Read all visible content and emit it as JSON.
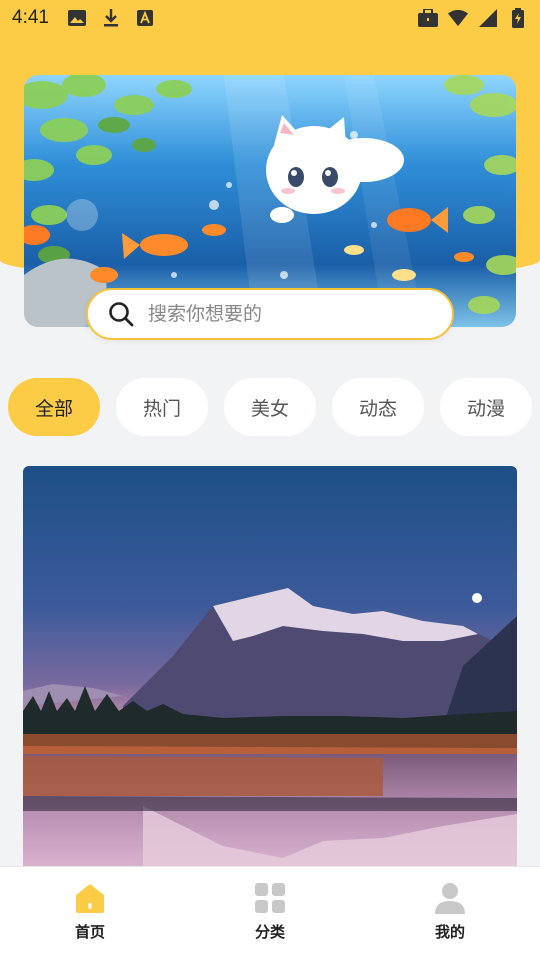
{
  "status_bar": {
    "time": "4:41",
    "left_icons": [
      "image-icon",
      "download-icon",
      "a-box-icon"
    ],
    "right_icons": [
      "briefcase-icon",
      "wifi-icon",
      "signal-icon",
      "battery-icon"
    ]
  },
  "colors": {
    "accent": "#fdcc47",
    "search_border": "#f5c33b",
    "background": "#f2f3f5"
  },
  "search": {
    "placeholder": "搜索你想要的"
  },
  "categories": [
    {
      "label": "全部",
      "active": true
    },
    {
      "label": "热门",
      "active": false
    },
    {
      "label": "美女",
      "active": false
    },
    {
      "label": "动态",
      "active": false
    },
    {
      "label": "动漫",
      "active": false
    }
  ],
  "banner": {
    "icon": "anime-cat-underwater-illustration"
  },
  "main_image": {
    "icon": "mountain-lake-sunset-photo"
  },
  "bottom_nav": [
    {
      "label": "首页",
      "icon": "home-icon",
      "active": true
    },
    {
      "label": "分类",
      "icon": "grid-icon",
      "active": false
    },
    {
      "label": "我的",
      "icon": "user-icon",
      "active": false
    }
  ]
}
